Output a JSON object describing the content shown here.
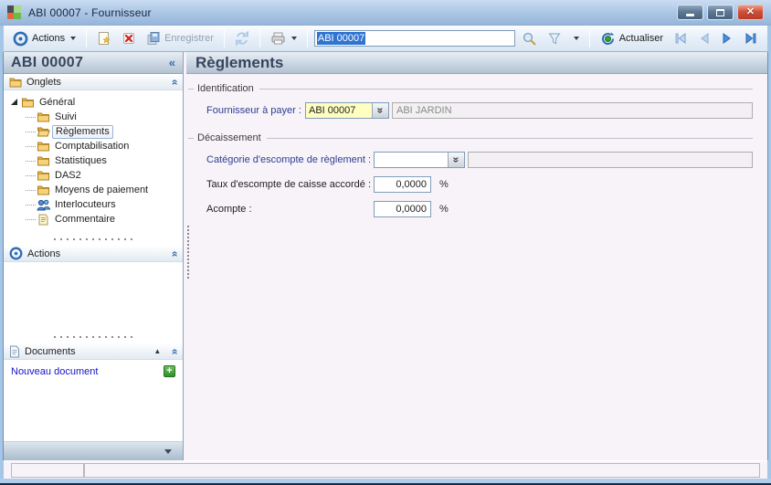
{
  "window": {
    "title": "ABI 00007 -  Fournisseur"
  },
  "toolbar": {
    "actions_label": "Actions",
    "save_label": "Enregistrer",
    "search_value": "ABI 00007",
    "refresh_label": "Actualiser"
  },
  "icons": {
    "collapse_left": "«",
    "panel_collapse": "»",
    "combo_expand": "»",
    "collapse_single": "▲",
    "new_document_plus": "+",
    "close_glyph": "x"
  },
  "sidebar": {
    "record_title": "ABI 00007",
    "panels": {
      "onglets": {
        "title": "Onglets"
      },
      "actions": {
        "title": "Actions"
      },
      "documents": {
        "title": "Documents",
        "new_document_label": "Nouveau document"
      }
    },
    "tree": [
      {
        "label": "Général"
      },
      {
        "label": "Suivi"
      },
      {
        "label": "Règlements"
      },
      {
        "label": "Comptabilisation"
      },
      {
        "label": "Statistiques"
      },
      {
        "label": "DAS2"
      },
      {
        "label": "Moyens de paiement"
      },
      {
        "label": "Interlocuteurs"
      },
      {
        "label": "Commentaire"
      }
    ]
  },
  "main": {
    "title": "Règlements",
    "identification": {
      "title": "Identification",
      "fournisseur_label": "Fournisseur à payer :",
      "fournisseur_value": "ABI 00007",
      "fournisseur_name": "ABI JARDIN"
    },
    "decaissement": {
      "title": "Décaissement",
      "categorie_label": "Catégorie d'escompte de règlement :",
      "categorie_value": "",
      "categorie_linked": "",
      "taux_label": "Taux d'escompte de caisse accordé :",
      "taux_value": "0,0000",
      "taux_suffix": "%",
      "acompte_label": "Acompte :",
      "acompte_value": "0,0000",
      "acompte_suffix": "%"
    }
  },
  "statusbar": {
    "left": "",
    "right": ""
  },
  "colors": {
    "accent_blue": "#3a6ea5",
    "combo_yellow": "#ffffc2",
    "close_red": "#c8432d",
    "selection_blue": "#2f74d0"
  }
}
